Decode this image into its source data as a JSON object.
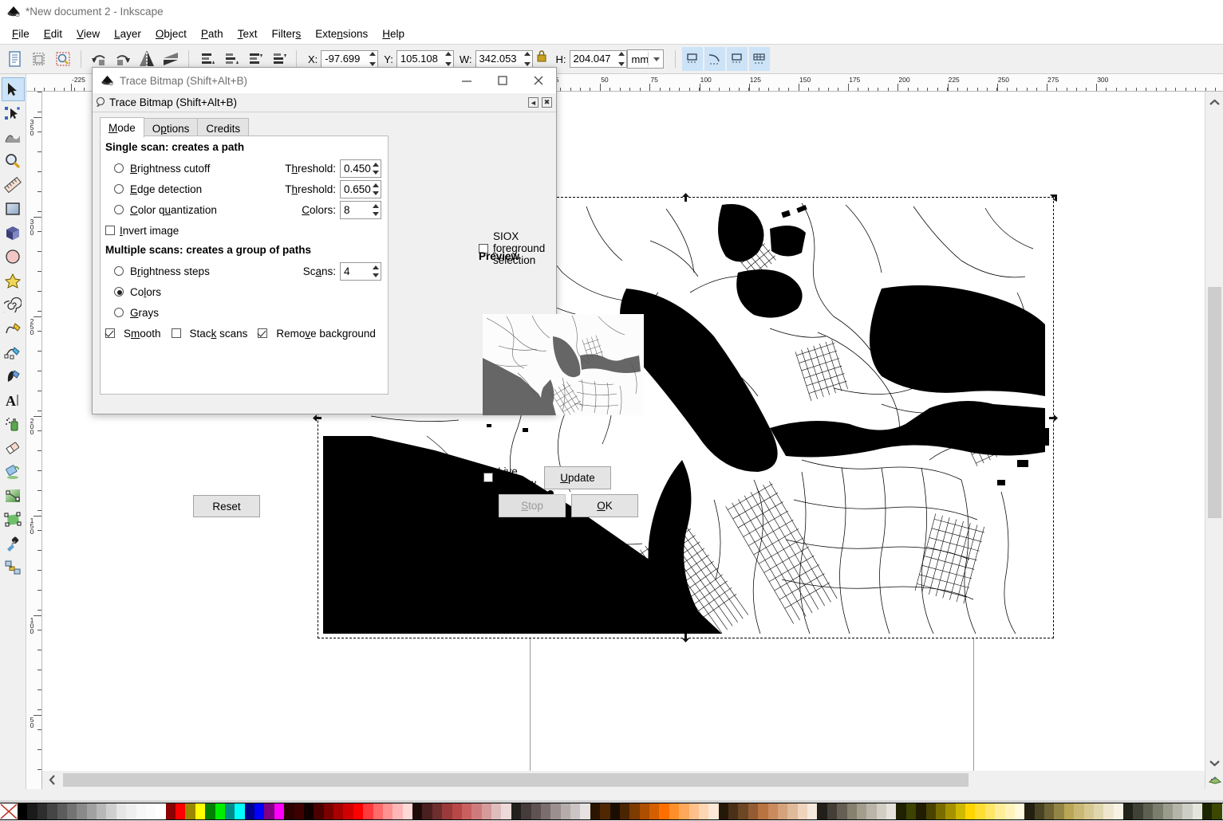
{
  "window": {
    "title": "*New document 2 - Inkscape",
    "app_icon": "inkscape-logo-icon"
  },
  "menubar": {
    "items": [
      {
        "label": "File",
        "accel_index": 0
      },
      {
        "label": "Edit",
        "accel_index": 0
      },
      {
        "label": "View",
        "accel_index": 0
      },
      {
        "label": "Layer",
        "accel_index": 0
      },
      {
        "label": "Object",
        "accel_index": 0
      },
      {
        "label": "Path",
        "accel_index": 0
      },
      {
        "label": "Text",
        "accel_index": 0
      },
      {
        "label": "Filters",
        "accel_index": 6
      },
      {
        "label": "Extensions",
        "accel_index": 4
      },
      {
        "label": "Help",
        "accel_index": 0
      }
    ]
  },
  "command_toolbar": {
    "icons": [
      "document-properties-icon",
      "layers-icon",
      "xml-editor-icon",
      "rotate-90-ccw-icon",
      "rotate-90-cw-icon",
      "flip-horizontal-icon",
      "flip-vertical-icon",
      "raise-to-top-icon",
      "raise-icon",
      "lower-icon",
      "lower-to-bottom-icon"
    ],
    "fields": [
      {
        "label": "X:",
        "value": "-97.699",
        "accel": "X"
      },
      {
        "label": "Y:",
        "value": "105.108",
        "accel": "Y"
      },
      {
        "label": "W:",
        "value": "342.053",
        "accel": "W"
      },
      {
        "label": "H:",
        "value": "204.047",
        "accel": "H"
      }
    ],
    "lock_icon": "lock-ratio-icon",
    "unit": "mm",
    "snap_buttons": [
      "snap-bounding-box-icon",
      "snap-path-icon",
      "snap-node-icon",
      "snap-grid-icon"
    ]
  },
  "toolbox": {
    "tools": [
      {
        "name": "selector-tool",
        "icon": "arrow-pointer-icon",
        "selected": true
      },
      {
        "name": "node-tool",
        "icon": "node-editor-icon",
        "selected": false
      },
      {
        "name": "tweak-tool",
        "icon": "tweak-icon",
        "selected": false
      },
      {
        "name": "zoom-tool",
        "icon": "magnifier-icon",
        "selected": false
      },
      {
        "name": "measure-tool",
        "icon": "ruler-icon",
        "selected": false
      },
      {
        "name": "rectangle-tool",
        "icon": "rectangle-icon",
        "selected": false
      },
      {
        "name": "3dbox-tool",
        "icon": "cube-icon",
        "selected": false
      },
      {
        "name": "ellipse-tool",
        "icon": "circle-icon",
        "selected": false
      },
      {
        "name": "star-tool",
        "icon": "star-icon",
        "selected": false
      },
      {
        "name": "spiral-tool",
        "icon": "spiral-icon",
        "selected": false
      },
      {
        "name": "pencil-tool",
        "icon": "pencil-icon",
        "selected": false
      },
      {
        "name": "bezier-tool",
        "icon": "pen-icon",
        "selected": false
      },
      {
        "name": "calligraphy-tool",
        "icon": "calligraphy-pen-icon",
        "selected": false
      },
      {
        "name": "text-tool",
        "icon": "text-a-icon",
        "selected": false
      },
      {
        "name": "spray-tool",
        "icon": "spray-can-icon",
        "selected": false
      },
      {
        "name": "eraser-tool",
        "icon": "eraser-icon",
        "selected": false
      },
      {
        "name": "paint-bucket-tool",
        "icon": "paint-bucket-icon",
        "selected": false
      },
      {
        "name": "gradient-tool",
        "icon": "gradient-icon",
        "selected": false
      },
      {
        "name": "mesh-gradient-tool",
        "icon": "mesh-gradient-icon",
        "selected": false
      },
      {
        "name": "dropper-tool",
        "icon": "eyedropper-icon",
        "selected": false
      },
      {
        "name": "connector-tool",
        "icon": "connector-icon",
        "selected": false
      }
    ]
  },
  "rulers": {
    "unit": "mm",
    "horizontal_labels": [
      "-225",
      "25",
      "50",
      "75",
      "100",
      "125",
      "150",
      "175",
      "200",
      "225",
      "250",
      "275",
      "300"
    ],
    "vertical_labels": [
      "350",
      "300",
      "250",
      "200",
      "150",
      "100",
      "50"
    ]
  },
  "trace_dialog": {
    "title": "Trace Bitmap (Shift+Alt+B)",
    "subtitle": "Trace Bitmap (Shift+Alt+B)",
    "titlebar_icon": "inkscape-logo-icon",
    "dock_icon": "trace-bitmap-icon",
    "window_controls": {
      "minimize": "minimize-icon",
      "maximize": "maximize-icon",
      "close": "close-icon"
    },
    "dock_controls": {
      "collapse": "collapse-icon",
      "close": "dock-close-icon"
    },
    "tabs": [
      {
        "label": "Mode",
        "accel": "M",
        "active": true
      },
      {
        "label": "Options",
        "accel": "p",
        "active": false
      },
      {
        "label": "Credits",
        "accel": "",
        "active": false
      }
    ],
    "single_scan": {
      "heading": "Single scan: creates a path",
      "options": [
        {
          "label": "Brightness cutoff",
          "selected": false,
          "field_label": "Threshold:",
          "field_value": "0.450"
        },
        {
          "label": "Edge detection",
          "selected": false,
          "field_label": "Threshold:",
          "field_value": "0.650"
        },
        {
          "label": "Color quantization",
          "selected": false,
          "field_label": "Colors:",
          "field_value": "8"
        }
      ],
      "invert": {
        "label": "Invert image",
        "checked": false
      }
    },
    "multiple_scans": {
      "heading": "Multiple scans: creates a group of paths",
      "options": [
        {
          "label": "Brightness steps",
          "selected": false,
          "field_label": "Scans:",
          "field_value": "4"
        },
        {
          "label": "Colors",
          "selected": true,
          "field_label": "",
          "field_value": ""
        },
        {
          "label": "Grays",
          "selected": false,
          "field_label": "",
          "field_value": ""
        }
      ],
      "checkboxes": [
        {
          "label": "Smooth",
          "checked": true
        },
        {
          "label": "Stack scans",
          "checked": false
        },
        {
          "label": "Remove background",
          "checked": true
        }
      ]
    },
    "siox": {
      "label": "SIOX foreground selection",
      "checked": false
    },
    "preview_label": "Preview",
    "live_preview": {
      "label": "Live Preview",
      "checked": false
    },
    "buttons": {
      "reset": "Reset",
      "update": "Update",
      "stop": "Stop",
      "stop_disabled": true,
      "ok": "OK"
    }
  },
  "canvas": {
    "content_description": "traced black-and-white street map of San Francisco Bay Area",
    "selection": {
      "visible": true,
      "handle_icon": "arrow-handle-icon"
    }
  },
  "scrollbars": {
    "vertical": {
      "up_icon": "chevron-up-icon",
      "down_icon": "chevron-down-icon"
    },
    "horizontal": {
      "left_icon": "chevron-left-icon",
      "right_icon": "chevron-right-icon"
    }
  },
  "palette": {
    "none_swatch": "no-color-icon",
    "colors": [
      "#000000",
      "#1a1a1a",
      "#2e2e2e",
      "#454545",
      "#5c5c5c",
      "#737373",
      "#8a8a8a",
      "#a1a1a1",
      "#b8b8b8",
      "#cfcfcf",
      "#e6e6e6",
      "#efefef",
      "#f7f7f7",
      "#fbfbfb",
      "#ffffff",
      "#8b0000",
      "#ff0000",
      "#998800",
      "#ffff00",
      "#008000",
      "#00ee00",
      "#008b8b",
      "#00ffff",
      "#00008b",
      "#0000ff",
      "#800080",
      "#ff00ff",
      "#2b0000",
      "#3d0000",
      "#110000",
      "#4a0000",
      "#7a0000",
      "#a80000",
      "#d10000",
      "#ff0000",
      "#ff3a3a",
      "#ff6a6a",
      "#ff9191",
      "#ffb6b6",
      "#ffd8d8",
      "#1f0a0a",
      "#4a1f1f",
      "#6e2e2e",
      "#9a3a3a",
      "#b84747",
      "#c86060",
      "#cf7b7b",
      "#d69a9a",
      "#dfbdbd",
      "#edd9d9",
      "#231f1f",
      "#453b3b",
      "#5e5252",
      "#7c6e6e",
      "#9b8f8f",
      "#b5acac",
      "#cbc4c4",
      "#e6e2e2",
      "#2b1500",
      "#4f2800",
      "#1b0d00",
      "#4b2400",
      "#7d3b00",
      "#ad4e00",
      "#d45e00",
      "#ff6f00",
      "#ff8f2a",
      "#ffa85a",
      "#ffc08c",
      "#ffd6b3",
      "#ffe9d6",
      "#241809",
      "#4a3018",
      "#6d4626",
      "#935c33",
      "#b97340",
      "#c98a5d",
      "#d6a27c",
      "#dfba9b",
      "#eed4bd",
      "#f5e8dc",
      "#221f1a",
      "#433e37",
      "#655e53",
      "#86806f",
      "#a39d8e",
      "#bab5a8",
      "#d2cec4",
      "#e6e3dd",
      "#1e2200",
      "#3d4300",
      "#201d00",
      "#4a4300",
      "#7a6d00",
      "#a59200",
      "#cfb800",
      "#ffd500",
      "#ffde33",
      "#ffe666",
      "#ffee99",
      "#fff3bb",
      "#fffadd",
      "#232010",
      "#4a4323",
      "#6d6334",
      "#938545",
      "#b9a656",
      "#c9b873",
      "#d6c891",
      "#dfd6ae",
      "#eee6ce",
      "#f7f2e4",
      "#212219",
      "#3f4136",
      "#5d6050",
      "#7b7d6c",
      "#9a9b8c",
      "#b4b5a8",
      "#cdcec4",
      "#e5e5de",
      "#1c2500",
      "#3c4800"
    ]
  }
}
